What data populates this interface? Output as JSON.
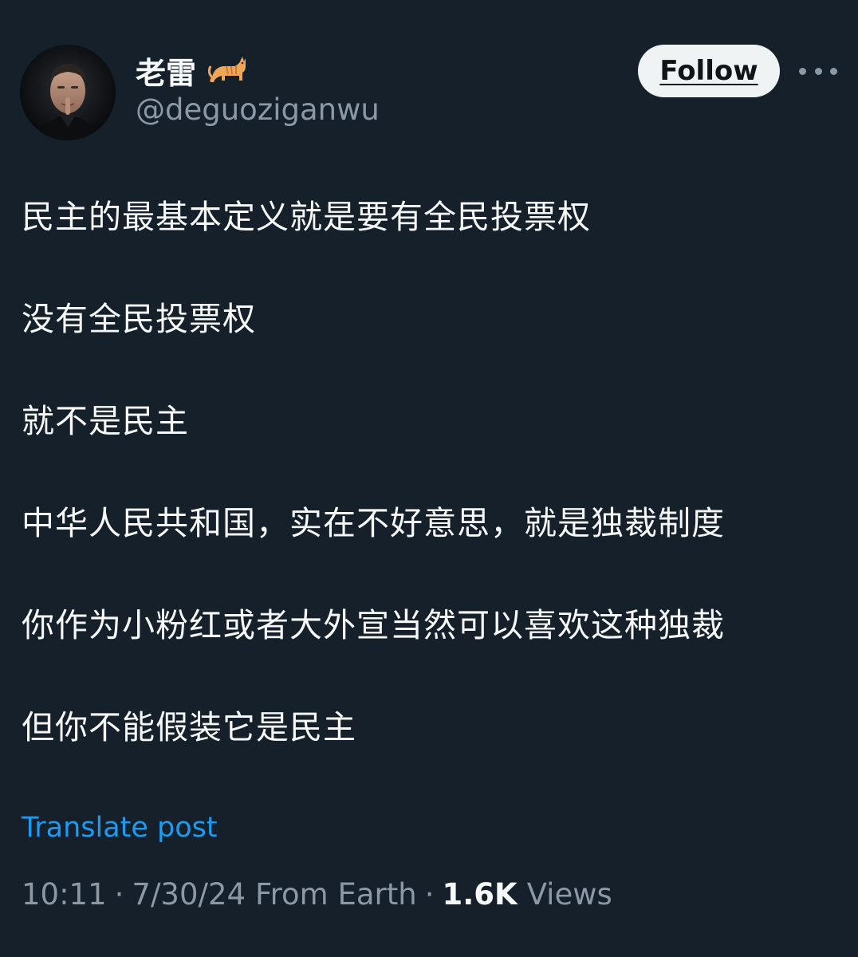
{
  "author": {
    "display_name": "老雷",
    "emoji_icon": "cat-icon",
    "handle": "@deguoziganwu",
    "avatar_icon": "profile-photo"
  },
  "actions": {
    "follow_label": "Follow",
    "more_icon": "more-horizontal-icon"
  },
  "post": {
    "lines": [
      "民主的最基本定义就是要有全民投票权",
      "没有全民投票权",
      "就不是民主",
      "中华人民共和国，实在不好意思，就是独裁制度",
      "你作为小粉红或者大外宣当然可以喜欢这种独裁",
      "但你不能假装它是民主"
    ],
    "translate_label": "Translate post"
  },
  "meta": {
    "time": "10:11",
    "separator": "·",
    "date": "7/30/24",
    "source": "From Earth",
    "views_count": "1.6K",
    "views_label": "Views"
  },
  "colors": {
    "background": "#15202b",
    "text_primary": "#f7f9f9",
    "text_secondary": "#8b98a5",
    "link": "#1d9bf0",
    "follow_button_bg": "#eff3f4"
  }
}
